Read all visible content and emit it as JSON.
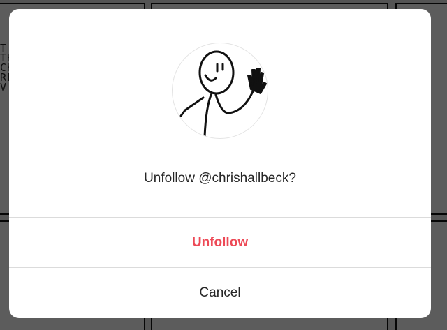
{
  "dialog": {
    "prompt": "Unfollow @chrishallbeck?",
    "unfollow_label": "Unfollow",
    "cancel_label": "Cancel",
    "unfollow_color": "#ed4956",
    "avatar_icon": "waving-stick-figure"
  },
  "background": {
    "scrawl_lines": [
      "T",
      "TH",
      "CH",
      "RE",
      "V."
    ]
  }
}
